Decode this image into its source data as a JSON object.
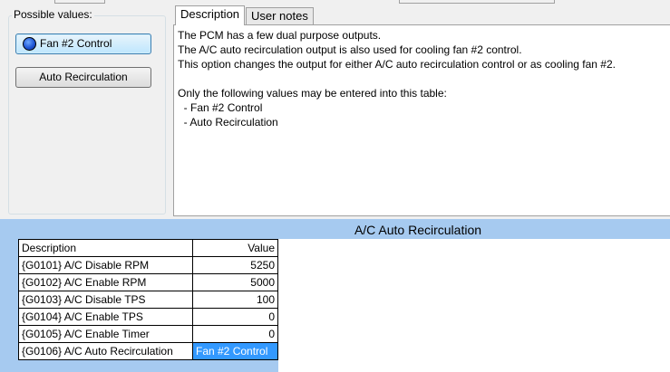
{
  "possible_values": {
    "title": "Possible values:",
    "options": [
      "Fan #2 Control",
      "Auto Recirculation"
    ],
    "selected_index": 0
  },
  "tabs": [
    {
      "label": "Description",
      "active": true
    },
    {
      "label": "User notes",
      "active": false
    }
  ],
  "description": {
    "lines": [
      "The PCM has a few dual purpose outputs.",
      "The A/C auto recirculation output is also used for cooling fan #2 control.",
      "This option changes the output for either A/C auto recirculation control or as cooling fan #2.",
      "",
      "Only the following values may be entered into this table:",
      "  - Fan #2 Control",
      "  - Auto Recirculation"
    ]
  },
  "table": {
    "title": "A/C Auto Recirculation",
    "headers": [
      "Description",
      "Value"
    ],
    "rows": [
      {
        "description": "{G0101} A/C Disable RPM",
        "value": "5250"
      },
      {
        "description": "{G0102} A/C Enable RPM",
        "value": "5000"
      },
      {
        "description": "{G0103} A/C Disable TPS",
        "value": "100"
      },
      {
        "description": "{G0104} A/C Enable TPS",
        "value": "0"
      },
      {
        "description": "{G0105} A/C Enable Timer",
        "value": "0"
      },
      {
        "description": "{G0106} A/C Auto Recirculation",
        "value": "Fan #2 Control",
        "selected": true
      }
    ]
  },
  "colors": {
    "table_background": "#a6caf0",
    "selection": "#3399ff"
  }
}
